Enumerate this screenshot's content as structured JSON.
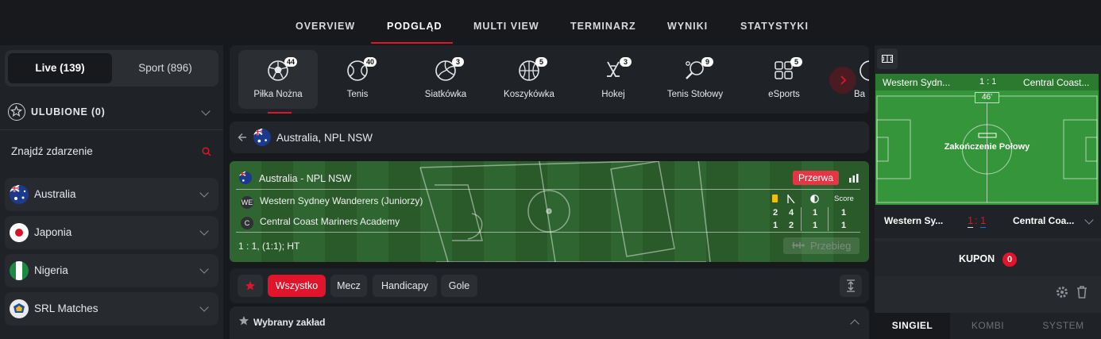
{
  "nav": {
    "items": [
      "OVERVIEW",
      "PODGLĄD",
      "MULTI VIEW",
      "TERMINARZ",
      "WYNIKI",
      "STATYSTYKI"
    ],
    "active": "PODGLĄD"
  },
  "sidebar": {
    "toggle": {
      "live": "Live (139)",
      "sport": "Sport (896)"
    },
    "favorites": "ULUBIONE (0)",
    "search_placeholder": "Znajdź zdarzenie",
    "countries": [
      {
        "name": "Australia"
      },
      {
        "name": "Japonia"
      },
      {
        "name": "Nigeria"
      },
      {
        "name": "SRL Matches"
      }
    ]
  },
  "sports": [
    {
      "label": "Piłka Nożna",
      "count": "44",
      "icon": "soccer-ball-icon"
    },
    {
      "label": "Tenis",
      "count": "40",
      "icon": "tennis-ball-icon"
    },
    {
      "label": "Siatkówka",
      "count": "3",
      "icon": "volleyball-icon"
    },
    {
      "label": "Koszykówka",
      "count": "5",
      "icon": "basketball-icon"
    },
    {
      "label": "Hokej",
      "count": "3",
      "icon": "hockey-sticks-icon"
    },
    {
      "label": "Tenis Stołowy",
      "count": "9",
      "icon": "table-tennis-icon"
    },
    {
      "label": "eSports",
      "count": "5",
      "icon": "esports-icon"
    },
    {
      "label": "Ba",
      "count": "",
      "icon": "baseball-icon"
    }
  ],
  "breadcrumb": {
    "title": "Australia, NPL NSW"
  },
  "match": {
    "league": "Australia - NPL NSW",
    "status": "Przerwa",
    "home": {
      "badge": "WE",
      "name": "Western Sydney Wanderers (Juniorzy)",
      "yellow": "2",
      "corners": "4",
      "half": "1",
      "score": "1"
    },
    "away": {
      "badge": "C",
      "name": "Central Coast Mariners Academy",
      "yellow": "1",
      "corners": "2",
      "half": "1",
      "score": "1"
    },
    "score_header": "Score",
    "summary": "1 : 1, (1:1); HT",
    "timeline_label": "Przebieg"
  },
  "filters": [
    "Wszystko",
    "Mecz",
    "Handicapy",
    "Gole"
  ],
  "picked_bet": "Wybrany zakład",
  "right": {
    "pitch_home": "Western Sydn...",
    "pitch_score": "1 : 1",
    "pitch_away": "Central Coast...",
    "minute": "46'",
    "pitch_status": "Zakończenie Połowy",
    "row_home": "Western Sy...",
    "row_score_home": "1",
    "row_score_sep": ":",
    "row_score_away": "1",
    "row_away": "Central Coa...",
    "kupon": "KUPON",
    "kupon_count": "0",
    "tabs": [
      "SINGIEL",
      "KOMBI",
      "SYSTEM"
    ]
  },
  "colors": {
    "accent": "#e0142a",
    "pitch": "#35953a",
    "bg": "#17191d",
    "panel": "#1f2226"
  }
}
